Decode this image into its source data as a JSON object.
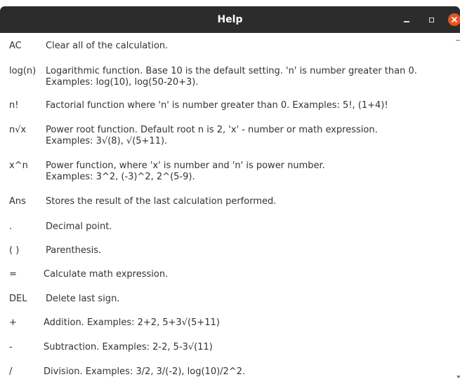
{
  "window": {
    "title": "Help"
  },
  "colors": {
    "titlebar": "#2c2c2c",
    "close_button": "#e95420",
    "text": "#333333",
    "background": "#ffffff"
  },
  "help_items": [
    {
      "key": "AC",
      "lines": [
        "Clear all of the calculation."
      ]
    },
    {
      "key": "log(n)",
      "lines": [
        "Logarithmic function. Base 10 is the default setting. 'n' is number greater than 0.",
        "Examples: log(10), log(50-20+3)."
      ]
    },
    {
      "key": "n!",
      "lines": [
        "Factorial function where 'n' is number greater than 0. Examples: 5!, (1+4)!"
      ]
    },
    {
      "key": "n√x",
      "lines": [
        "Power root function. Default root n is 2, 'x' - number or math expression.",
        "Examples: 3√(8), √(5+11)."
      ]
    },
    {
      "key": "x^n",
      "lines": [
        "Power function, where 'x' is number and 'n' is power number.",
        "Examples: 3^2, (-3)^2, 2^(5-9)."
      ]
    },
    {
      "key": "Ans",
      "lines": [
        "Stores the result of the last calculation performed."
      ]
    },
    {
      "key": ".",
      "lines": [
        "Decimal point."
      ]
    },
    {
      "key": "( )",
      "lines": [
        "Parenthesis."
      ]
    },
    {
      "key": "=",
      "lines": [
        "Calculate math expression."
      ]
    },
    {
      "key": "DEL",
      "lines": [
        "Delete last sign."
      ]
    },
    {
      "key": "+",
      "lines": [
        "Addition. Examples: 2+2, 5+3√(5+11)"
      ]
    },
    {
      "key": "-",
      "lines": [
        "Subtraction. Examples: 2-2, 5-3√(11)"
      ]
    },
    {
      "key": "/",
      "lines": [
        "Division. Examples: 3/2, 3/(-2), log(10)/2^2."
      ]
    }
  ]
}
